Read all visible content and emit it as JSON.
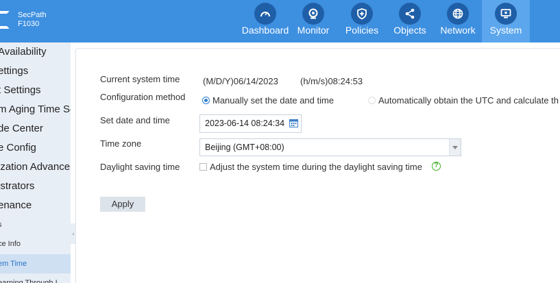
{
  "brand": {
    "line1": "SecPath",
    "line2": "F1030"
  },
  "nav": [
    {
      "label": "Dashboard",
      "icon": "gauge-icon"
    },
    {
      "label": "Monitor",
      "icon": "webcam-icon"
    },
    {
      "label": "Policies",
      "icon": "shield-icon"
    },
    {
      "label": "Objects",
      "icon": "share-nodes-icon"
    },
    {
      "label": "Network",
      "icon": "globe-icon"
    },
    {
      "label": "System",
      "icon": "monitor-icon",
      "active": true
    }
  ],
  "sidebar": {
    "items": [
      {
        "label": "Availability"
      },
      {
        "label": "ettings"
      },
      {
        "label": "t Settings"
      },
      {
        "label": "m Aging Time Se"
      },
      {
        "label": "de Center"
      },
      {
        "label": "e Config"
      },
      {
        "label": "ization Advance"
      },
      {
        "label": "istrators"
      },
      {
        "label": "enance"
      },
      {
        "label": "s"
      },
      {
        "label": "ce Info"
      },
      {
        "label": "em Time"
      },
      {
        "label": "earning Through I"
      }
    ]
  },
  "form": {
    "current_time_label": "Current system time",
    "current_date": "(M/D/Y)06/14/2023",
    "current_time": "(h/m/s)08:24:53",
    "config_method_label": "Configuration method",
    "manual_option": "Manually set the date and time",
    "auto_option": "Automatically obtain the UTC and calculate th",
    "set_datetime_label": "Set date and time",
    "datetime_value": "2023-06-14 08:24:34",
    "timezone_label": "Time zone",
    "timezone_value": "Beijing (GMT+08:00)",
    "dst_label": "Daylight saving time",
    "dst_option": "Adjust the system time during the daylight saving time",
    "help_glyph": "?",
    "apply_label": "Apply"
  },
  "colors": {
    "topbar": "#3d8fe0",
    "accent": "#2f7fd4",
    "help": "#43b02a"
  }
}
